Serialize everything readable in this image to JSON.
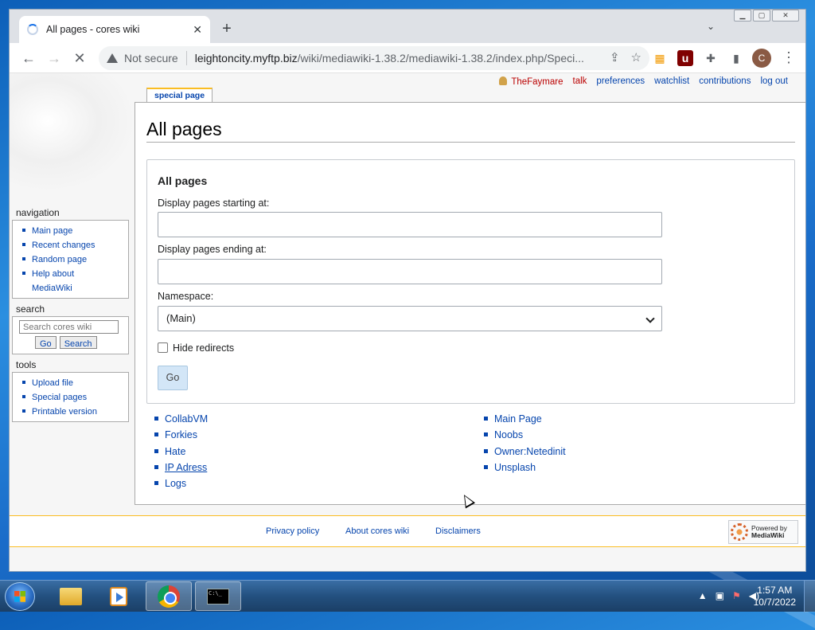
{
  "browser": {
    "tab_title": "All pages - cores wiki",
    "tab_close": "✕",
    "new_tab": "+",
    "tab_search": "⌄",
    "window_buttons": {
      "minimize": "▁",
      "maximize": "▢",
      "close": "✕"
    },
    "nav": {
      "back": "←",
      "forward": "→",
      "stop": "✕"
    },
    "address": {
      "security_label": "Not secure",
      "host": "leightoncity.myftp.biz",
      "path": "/wiki/mediawiki-1.38.2/mediawiki-1.38.2/index.php/Speci..."
    },
    "omnibox_icons": {
      "share": "⇪",
      "bookmark": "☆"
    },
    "extensions": {
      "rss": "▦",
      "ublock": "u",
      "puzzle": "✚",
      "sidepanel": "▮"
    },
    "profile_initial": "C",
    "menu": "⋮"
  },
  "wiki": {
    "personal_tools": {
      "user": "TheFaymare",
      "talk": "talk",
      "preferences": "preferences",
      "watchlist": "watchlist",
      "contributions": "contributions",
      "logout": "log out"
    },
    "special_tab": "special page",
    "heading": "All pages",
    "form": {
      "legend": "All pages",
      "from_label": "Display pages starting at:",
      "from_value": "",
      "to_label": "Display pages ending at:",
      "to_value": "",
      "namespace_label": "Namespace:",
      "namespace_value": "(Main)",
      "hide_redirects_label": "Hide redirects",
      "hide_redirects_checked": false,
      "go_label": "Go"
    },
    "pages_col1": [
      "CollabVM",
      "Forkies",
      "Hate",
      "IP Adress",
      "Logs"
    ],
    "pages_col2": [
      "Main Page",
      "Noobs",
      "Owner:Netedinit",
      "Unsplash"
    ],
    "sidebar": {
      "navigation_heading": "navigation",
      "navigation": [
        "Main page",
        "Recent changes",
        "Random page",
        "Help about",
        "MediaWiki"
      ],
      "search_heading": "search",
      "search_placeholder": "Search cores wiki",
      "search_go": "Go",
      "search_search": "Search",
      "tools_heading": "tools",
      "tools": [
        "Upload file",
        "Special pages",
        "Printable version"
      ]
    },
    "footer": {
      "privacy": "Privacy policy",
      "about": "About cores wiki",
      "disclaimers": "Disclaimers",
      "powered_line1": "Powered by",
      "powered_line2": "MediaWiki"
    }
  },
  "taskbar": {
    "time": "1:57 AM",
    "date": "10/7/2022",
    "tray_icons": {
      "arrow": "▲",
      "network": "▣",
      "flag": "⚑",
      "volume": "◀)"
    }
  },
  "colors": {
    "link": "#0645ad",
    "user_link": "#ba0000",
    "footer_rule": "#fabd23",
    "taskbar": "#23507f"
  }
}
